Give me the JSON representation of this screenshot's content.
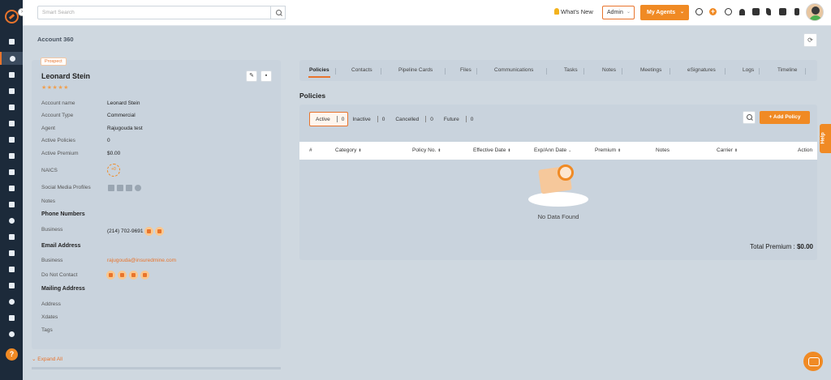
{
  "topbar": {
    "search_placeholder": "Smart Search",
    "whats_new": "What's New",
    "admin": "Admin",
    "my_agents": "My Agents"
  },
  "page": {
    "title": "Account 360"
  },
  "account": {
    "badge": "Prospect",
    "name": "Leonard Stein",
    "rating_stars": "★★★★★",
    "naics_icon_text": "+0",
    "fields": [
      {
        "label": "Account name",
        "value": "Leonard Stein"
      },
      {
        "label": "Account Type",
        "value": "Commercial"
      },
      {
        "label": "Agent",
        "value": "Rajugouda test"
      },
      {
        "label": "Active Policies",
        "value": "0"
      },
      {
        "label": "Active Premium",
        "value": "$0.00"
      },
      {
        "label": "NAICS",
        "value": ""
      },
      {
        "label": "Social Media Profiles",
        "value": ""
      },
      {
        "label": "Notes",
        "value": ""
      }
    ],
    "phone_section": "Phone Numbers",
    "phone_label": "Business",
    "phone_value": "(214) 702-9691",
    "email_section": "Email Address",
    "email_label": "Business",
    "email_value": "rajugouda@insuredmine.com",
    "do_not_contact": "Do Not Contact",
    "mailing_section": "Mailing Address",
    "address_label": "Address",
    "xdates_label": "Xdates",
    "tags_label": "Tags",
    "expand_all": "Expand All"
  },
  "tabs": [
    {
      "label": "Policies",
      "active": true
    },
    {
      "label": "Contacts"
    },
    {
      "label": "Pipeline Cards"
    },
    {
      "label": "Files"
    },
    {
      "label": "Communications"
    },
    {
      "label": "Tasks"
    },
    {
      "label": "Notes"
    },
    {
      "label": "Meetings"
    },
    {
      "label": "eSignatures"
    },
    {
      "label": "Logs"
    },
    {
      "label": "Timeline"
    }
  ],
  "policies": {
    "title": "Policies",
    "filters": [
      {
        "label": "Active",
        "count": "0"
      },
      {
        "label": "Inactive",
        "count": "0"
      },
      {
        "label": "Cancelled",
        "count": "0"
      },
      {
        "label": "Future",
        "count": "0"
      }
    ],
    "add_button": "+ Add Policy",
    "columns": [
      "#",
      "Category",
      "Policy No.",
      "Effective Date",
      "Exp/Ann Date",
      "Premium",
      "Notes",
      "Carrier",
      "Action"
    ],
    "empty_text": "No Data Found",
    "total_label": "Total Premium :",
    "total_value": "$0.00"
  },
  "help_tab": "Help",
  "colors": {
    "accent": "#f08a24",
    "sidebar": "#1c2a3a",
    "panel": "#c9d3dd"
  }
}
